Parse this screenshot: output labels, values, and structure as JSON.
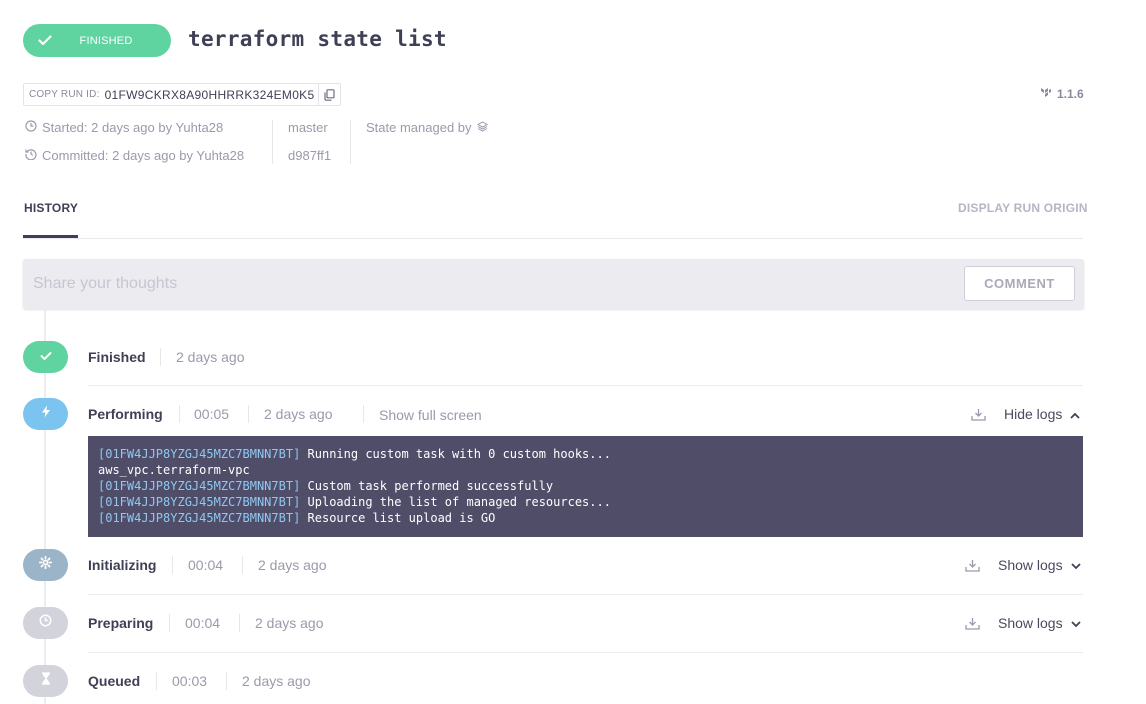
{
  "header": {
    "status_label": "FINISHED",
    "title": "terraform state list"
  },
  "run": {
    "copy_label": "COPY RUN ID:",
    "run_id": "01FW9CKRX8A90HHRRK324EM0K5",
    "version": "1.1.6",
    "started": "Started: 2 days ago by Yuhta28",
    "committed": "Committed: 2 days ago by Yuhta28",
    "branch": "master",
    "commit": "d987ff1",
    "state_managed": "State managed by"
  },
  "tabs": {
    "history": "HISTORY",
    "display_origin": "DISPLAY RUN ORIGIN"
  },
  "comment": {
    "placeholder": "Share your thoughts",
    "button": "COMMENT"
  },
  "steps": [
    {
      "name": "Finished",
      "duration": "",
      "time": "2 days ago",
      "extra": "",
      "log_label": "",
      "color": "#5fd3a0"
    },
    {
      "name": "Performing",
      "duration": "00:05",
      "time": "2 days ago",
      "extra": "Show full screen",
      "log_label": "Hide logs",
      "color": "#7cc4f0"
    },
    {
      "name": "Initializing",
      "duration": "00:04",
      "time": "2 days ago",
      "extra": "",
      "log_label": "Show logs",
      "color": "#9cb4c8"
    },
    {
      "name": "Preparing",
      "duration": "00:04",
      "time": "2 days ago",
      "extra": "",
      "log_label": "Show logs",
      "color": "#d3d3dc"
    },
    {
      "name": "Queued",
      "duration": "00:03",
      "time": "2 days ago",
      "extra": "",
      "log_label": "",
      "color": "#d3d3dc"
    }
  ],
  "logs": [
    {
      "id": "[01FW4JJP8YZGJ45MZC7BMNN7BT]",
      "msg": " Running custom task with 0 custom hooks..."
    },
    {
      "id": "",
      "msg": "aws_vpc.terraform-vpc"
    },
    {
      "id": "[01FW4JJP8YZGJ45MZC7BMNN7BT]",
      "msg": " Custom task performed successfully"
    },
    {
      "id": "[01FW4JJP8YZGJ45MZC7BMNN7BT]",
      "msg": " Uploading the list of managed resources..."
    },
    {
      "id": "[01FW4JJP8YZGJ45MZC7BMNN7BT]",
      "msg": " Resource list upload is GO"
    }
  ]
}
